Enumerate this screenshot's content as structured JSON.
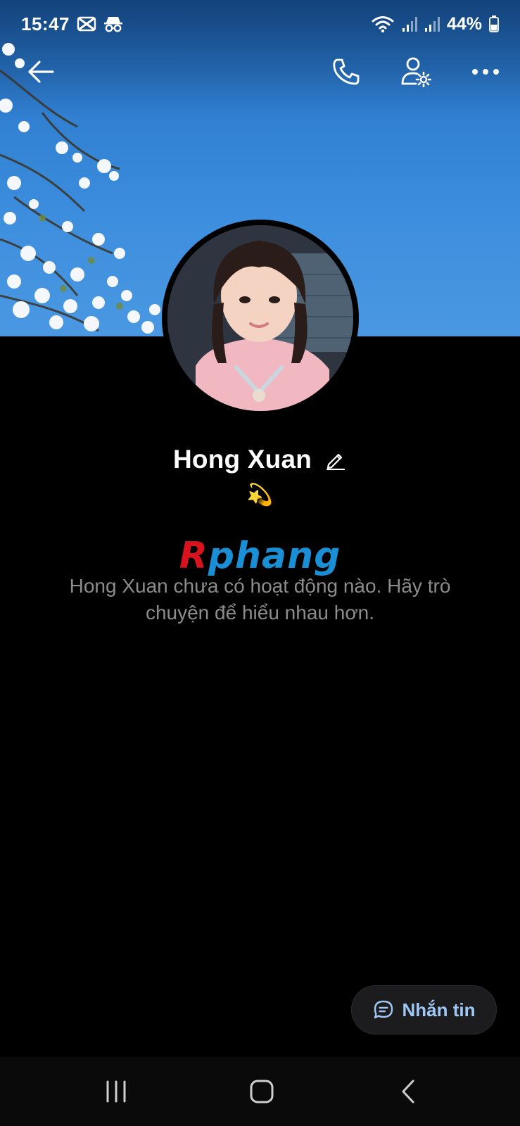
{
  "status_bar": {
    "time": "15:47",
    "battery": "44%"
  },
  "app_bar": {
    "back_icon": "arrow-left-icon",
    "call_icon": "phone-icon",
    "settings_icon": "user-settings-icon",
    "more_icon": "more-horizontal-icon"
  },
  "profile": {
    "name": "Hong Xuan",
    "status_emoji": "💫",
    "empty_message": "Hong Xuan chưa có hoạt động nào. Hãy trò chuyện để hiểu nhau hơn."
  },
  "watermark": {
    "part_a": "R",
    "part_b": "phang"
  },
  "message_button": {
    "label": "Nhắn tin",
    "icon": "chat-bubble-icon",
    "text_color": "#9fc8f5"
  },
  "colors": {
    "background": "#000000",
    "sky": "#3d8ede",
    "accent": "#9fc8f5"
  }
}
